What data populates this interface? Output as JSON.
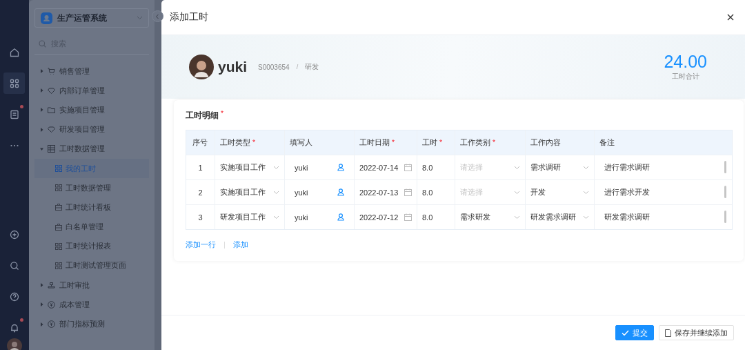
{
  "rail": {
    "items": [
      {
        "kind": "home",
        "selected": false,
        "badge": false
      },
      {
        "kind": "apps",
        "selected": true,
        "badge": false
      },
      {
        "kind": "document",
        "selected": false,
        "badge": true
      },
      {
        "kind": "more",
        "selected": false,
        "badge": false
      },
      {
        "kind": "add",
        "selected": false,
        "badge": false
      },
      {
        "kind": "search",
        "selected": false,
        "badge": false
      },
      {
        "kind": "help",
        "selected": false,
        "badge": false
      },
      {
        "kind": "bell",
        "selected": false,
        "badge": true
      }
    ]
  },
  "sidebar": {
    "system": "生产运管系统",
    "search": {
      "placeholder": "搜索"
    },
    "menu": [
      {
        "label": "销售管理",
        "kind": "cart",
        "expanded": false
      },
      {
        "label": "内部订单管理",
        "kind": "gem",
        "expanded": false
      },
      {
        "label": "实施项目管理",
        "kind": "folder",
        "expanded": false
      },
      {
        "label": "研发项目管理",
        "kind": "gem",
        "expanded": false
      },
      {
        "label": "工时数据管理",
        "kind": "table",
        "expanded": true,
        "children": [
          {
            "label": "我的工时",
            "kind": "grid",
            "selected": true
          },
          {
            "label": "工时数据管理",
            "kind": "grid",
            "selected": false
          },
          {
            "label": "工时统计看板",
            "kind": "case",
            "selected": false
          },
          {
            "label": "白名单管理",
            "kind": "case",
            "selected": false
          },
          {
            "label": "工时统计报表",
            "kind": "grid",
            "selected": false
          },
          {
            "label": "工时测试管理页面",
            "kind": "grid",
            "selected": false
          }
        ]
      },
      {
        "label": "工时审批",
        "kind": "stamp",
        "expanded": false
      },
      {
        "label": "成本管理",
        "kind": "coin",
        "expanded": false
      },
      {
        "label": "部门指标预测",
        "kind": "coin",
        "expanded": false
      }
    ]
  },
  "dialog": {
    "title": "添加工时",
    "profile": {
      "name": "yuki",
      "id": "S0003654",
      "separator": "/",
      "department": "研发",
      "total": "24.00",
      "total_label": "工时合计"
    },
    "section": {
      "title": "工时明细",
      "required_mark": "*"
    },
    "table": {
      "columns": [
        {
          "label": "序号"
        },
        {
          "label": "工时类型",
          "required_mark": "*"
        },
        {
          "label": "填写人"
        },
        {
          "label": "工时日期",
          "required_mark": "*"
        },
        {
          "label": "工时",
          "required_mark": "*"
        },
        {
          "label": "工作类别",
          "required_mark": "*"
        },
        {
          "label": "工作内容"
        },
        {
          "label": "备注"
        }
      ],
      "rows": [
        {
          "index": "1",
          "type": "实施项目工作",
          "filler": "yuki",
          "date": "2022-07-14",
          "hours": "8.0",
          "category": {
            "placeholder": "请选择"
          },
          "content": "需求调研",
          "remark": "进行需求调研"
        },
        {
          "index": "2",
          "type": "实施项目工作",
          "filler": "yuki",
          "date": "2022-07-13",
          "hours": "8.0",
          "category": {
            "placeholder": "请选择"
          },
          "content": "开发",
          "remark": "进行需求开发"
        },
        {
          "index": "3",
          "type": "研发项目工作",
          "filler": "yuki",
          "date": "2022-07-12",
          "hours": "8.0",
          "category": {
            "value": "需求研发"
          },
          "content": "研发需求调研",
          "remark": "研发需求调研"
        }
      ]
    },
    "links": [
      "添加一行",
      "添加"
    ],
    "buttons": [
      {
        "label": "提交",
        "kind": "primary"
      },
      {
        "label": "保存并继续添加",
        "kind": "default"
      }
    ]
  }
}
